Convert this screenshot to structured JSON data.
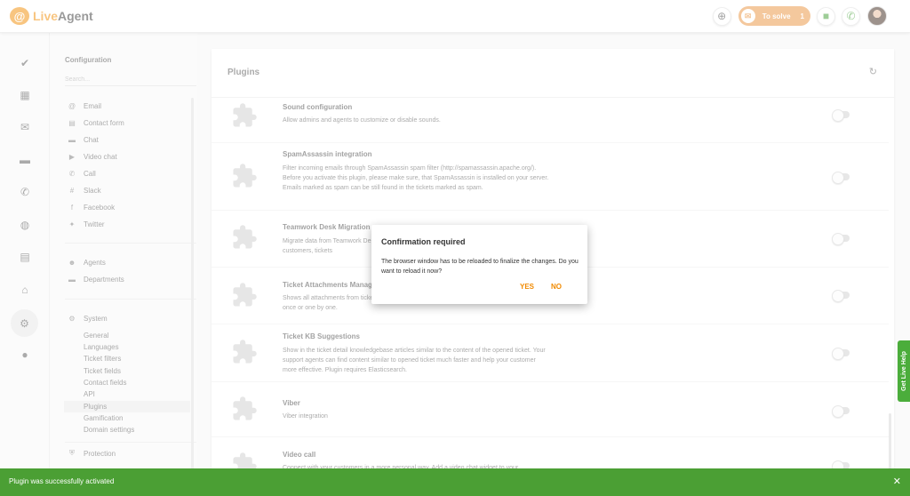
{
  "app": {
    "logo_mark": "@",
    "logo_live": "Live",
    "logo_agent": "Agent"
  },
  "topbar": {
    "to_solve_label": "To solve",
    "to_solve_count": "1"
  },
  "config": {
    "title": "Configuration",
    "search_placeholder": "Search...",
    "channels": [
      "Email",
      "Contact form",
      "Chat",
      "Video chat",
      "Call",
      "Slack",
      "Facebook",
      "Twitter"
    ],
    "people": [
      "Agents",
      "Departments"
    ],
    "system_label": "System",
    "system_items": [
      "General",
      "Languages",
      "Ticket filters",
      "Ticket fields",
      "Contact fields",
      "API",
      "Plugins",
      "Gamification",
      "Domain settings"
    ],
    "protection_label": "Protection"
  },
  "main": {
    "title": "Plugins",
    "plugins": [
      {
        "title": "Sound configuration",
        "desc": "Allow admins and agents to customize or disable sounds."
      },
      {
        "title": "SpamAssassin integration",
        "desc": "Filter incoming emails through SpamAssassin spam filter (http://spamassassin.apache.org/). Before you activate this plugin, please make sure, that SpamAssassin is installed on your server. Emails marked as spam can be still found in the tickets marked as spam."
      },
      {
        "title": "Teamwork Desk Migration",
        "desc": "Migrate data from Teamwork Desk customers, tickets"
      },
      {
        "title": "Ticket Attachments Manager",
        "desc": "Shows all attachments from ticket, download all attachments at once or one by one."
      },
      {
        "title": "Ticket KB Suggestions",
        "desc": "Show in the ticket detail knowledgebase articles similar to the content of the opened ticket. Your support agents can find content similar to opened ticket much faster and help your customer more effective. Plugin requires Elasticsearch."
      },
      {
        "title": "Viber",
        "desc": "Viber integration"
      },
      {
        "title": "Video call",
        "desc": "Connect with your customers in a more personal way. Add a video chat widget to your"
      }
    ]
  },
  "dialog": {
    "title": "Confirmation required",
    "body": "The browser window has to be reloaded to finalize the changes. Do you want to reload it now?",
    "yes": "YES",
    "no": "NO"
  },
  "live_help": "Get Live Help",
  "toast": {
    "message": "Plugin was successfully activated",
    "close": "✕"
  },
  "colors": {
    "accent": "#f18a00",
    "success": "#4b9f34",
    "help": "#4bad3b"
  },
  "icons": {
    "rail": [
      "check-circle-icon",
      "dashboard-icon",
      "mail-icon",
      "chat-icon",
      "phone-icon",
      "contacts-icon",
      "calendar-icon",
      "bank-icon",
      "gear-icon",
      "plugin-icon"
    ]
  }
}
